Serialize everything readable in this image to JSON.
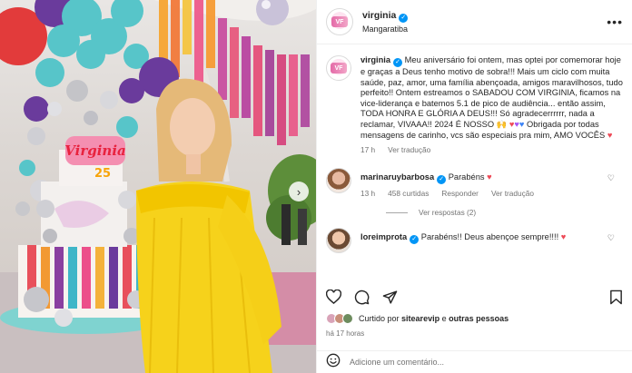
{
  "post": {
    "username": "virginia",
    "location": "Mangaratiba"
  },
  "caption": {
    "username": "virginia",
    "text_part1": "Meu aniversário foi ontem, mas optei por comemorar hoje e graças a Deus tenho motivo de sobra!!! Mais um ciclo com muita saúde, paz, amor, uma família abençoada, amigos maravilhosos, tudo perfeito!! Ontem estreamos o SABADOU COM VIRGINIA, ficamos na vice-liderança e batemos 5.1 de pico de audiência... então assim, TODA HONRA E GLÓRIA A DEUS!!! Só agradecerrrrrr, nada a reclamar, VIVAAA!! 2024 É NOSSO",
    "text_part2": "Obrigada por todas mensagens de carinho, vcs são especiais pra mim, AMO VOCÊS",
    "time": "17 h",
    "see_translation": "Ver tradução"
  },
  "comments": [
    {
      "username": "marinaruybarbosa",
      "text": "Parabéns",
      "time": "13 h",
      "likes": "458 curtidas",
      "reply": "Responder",
      "see_translation": "Ver tradução",
      "view_replies": "Ver respostas (2)"
    },
    {
      "username": "loreimprota",
      "text": "Parabéns!! Deus abençoe sempre!!!!"
    }
  ],
  "likes": {
    "prefix": "Curtido por",
    "user": "sitearevip",
    "conjunction": "e",
    "others": "outras pessoas"
  },
  "time_ago": "há 17 horas",
  "add_comment": {
    "placeholder": "Adicione um comentário..."
  },
  "cake_text": {
    "name": "Virginia",
    "number": "25"
  },
  "icons": {
    "more": "more-icon",
    "like": "heart-icon",
    "comment": "comment-icon",
    "share": "share-icon",
    "save": "bookmark-icon",
    "emoji": "emoji-icon",
    "next": "chevron-right-icon"
  },
  "colors": {
    "verified": "#0095f6",
    "heart": "#ed4956",
    "dress": "#f6d21b",
    "balloon_teal": "#57c5c9",
    "balloon_purple": "#6a3b9c"
  }
}
